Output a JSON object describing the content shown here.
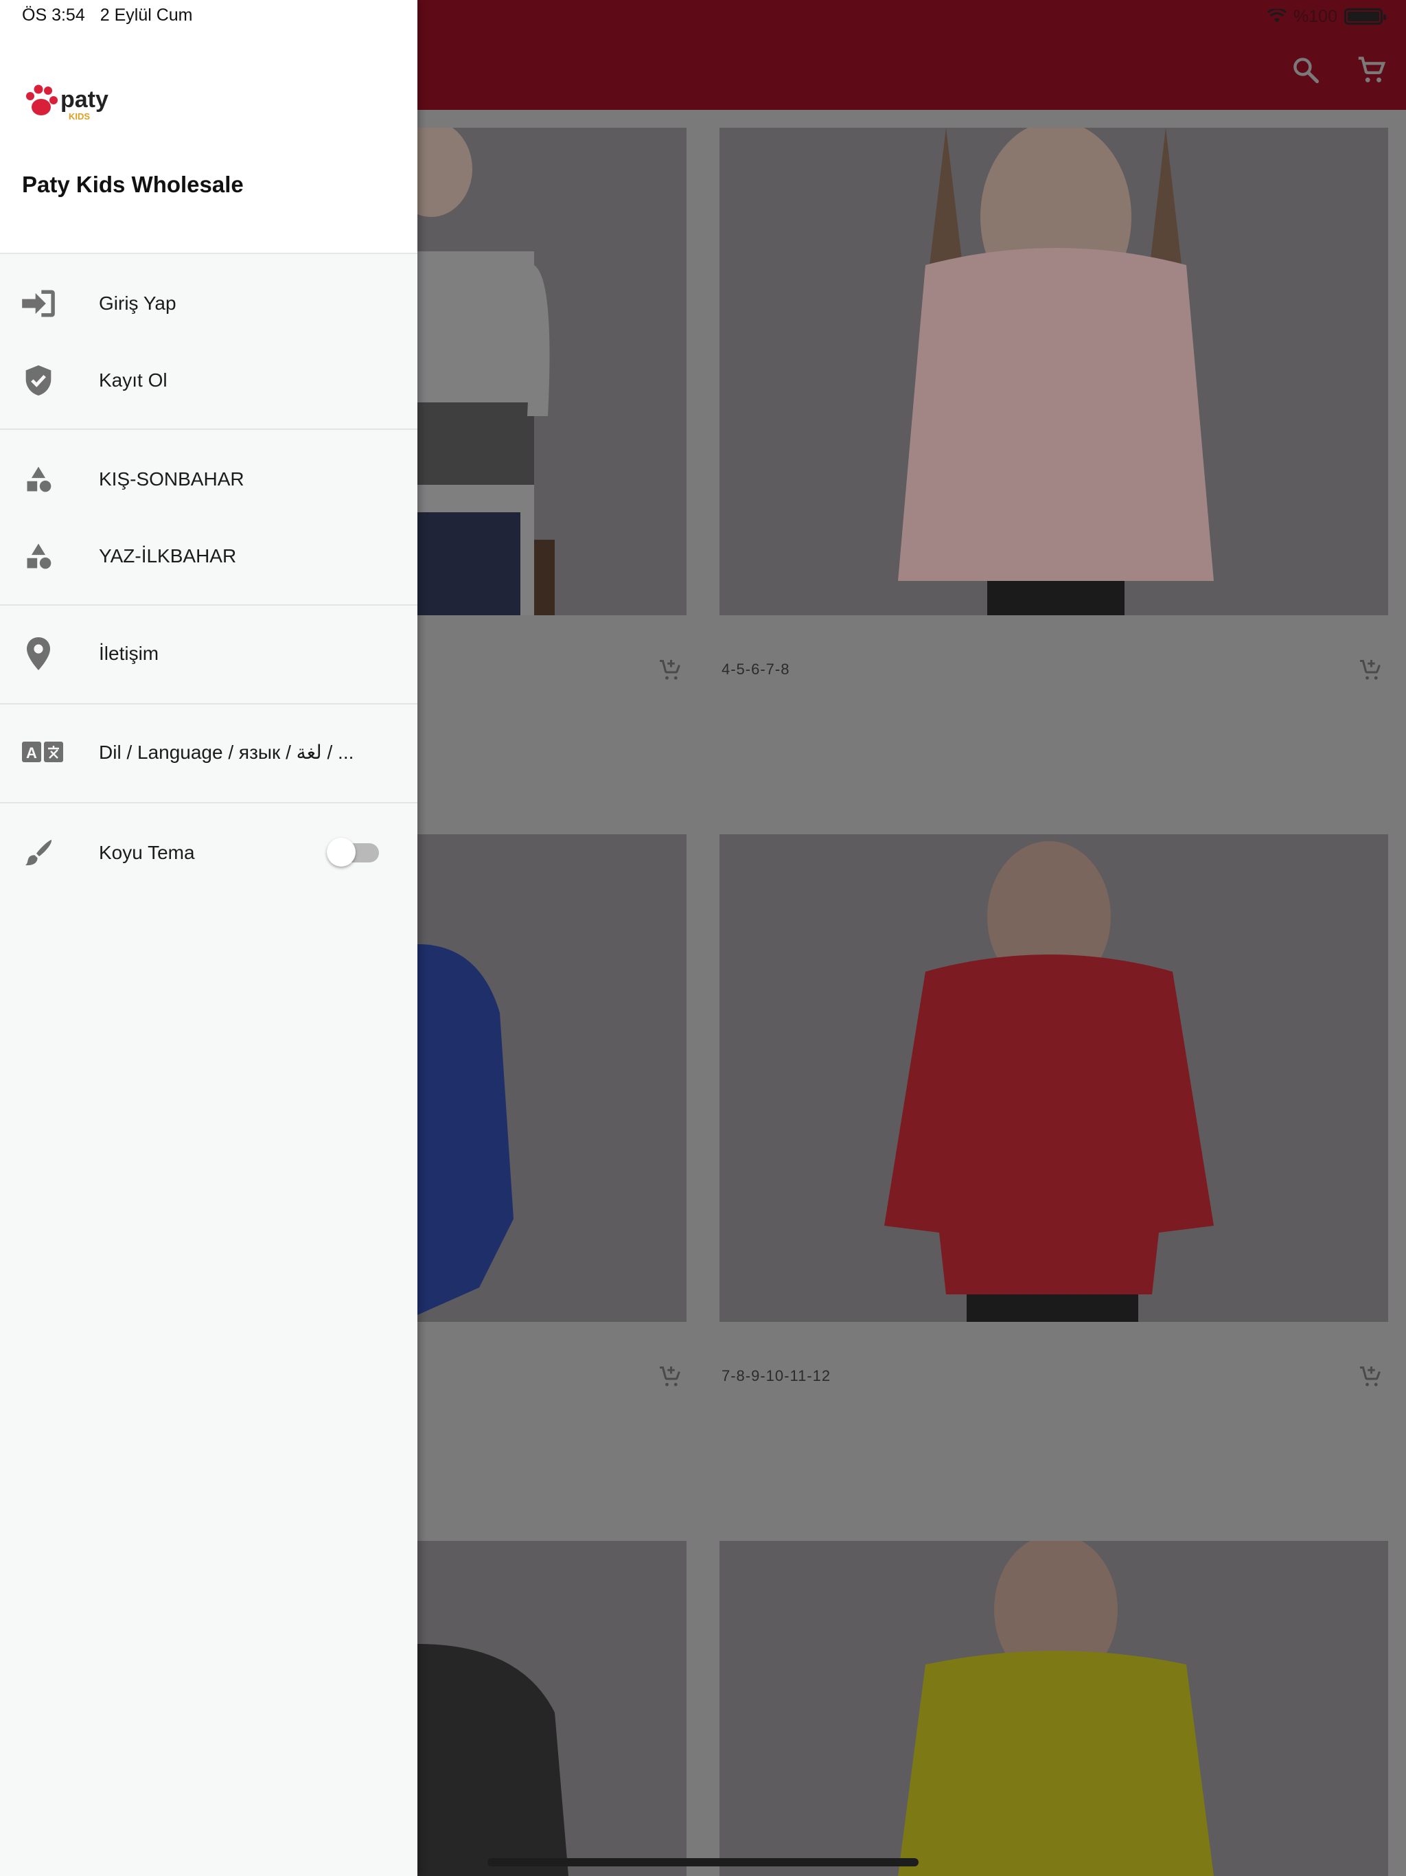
{
  "status_bar": {
    "time": "ÖS 3:54",
    "date": "2 Eylül Cum",
    "battery": "%100"
  },
  "drawer": {
    "app_title": "Paty Kids Wholesale",
    "logo_text": "paty",
    "logo_subtext": "KIDS",
    "items": [
      {
        "label": "Giriş Yap",
        "icon": "login-icon"
      },
      {
        "label": "Kayıt Ol",
        "icon": "shield-check-icon"
      },
      {
        "label": "KIŞ-SONBAHAR",
        "icon": "category-icon"
      },
      {
        "label": "YAZ-İLKBAHAR",
        "icon": "category-icon"
      },
      {
        "label": "İletişim",
        "icon": "location-pin-icon"
      },
      {
        "label": "Dil / Language / язык / لغة / ...",
        "icon": "translate-icon"
      },
      {
        "label": "Koyu Tema",
        "icon": "brush-icon"
      }
    ],
    "dark_theme_enabled": false
  },
  "products": [
    {
      "sizes": "",
      "shirt_color": "#7f7f80"
    },
    {
      "sizes": "4-5-6-7-8",
      "shirt_color": "#a18685"
    },
    {
      "sizes": "",
      "shirt_color": "#1e2f6a"
    },
    {
      "sizes": "7-8-9-10-11-12",
      "shirt_color": "#7d1b22"
    },
    {
      "sizes": "",
      "shirt_color": "#262626"
    },
    {
      "sizes": "",
      "shirt_color": "#7d7a16"
    }
  ],
  "colors": {
    "appbar": "#5f0a17",
    "scrim_background": "#7a7a7a",
    "drawer_bg": "#f7f8f8",
    "icon_grey": "#6f6f6f"
  }
}
